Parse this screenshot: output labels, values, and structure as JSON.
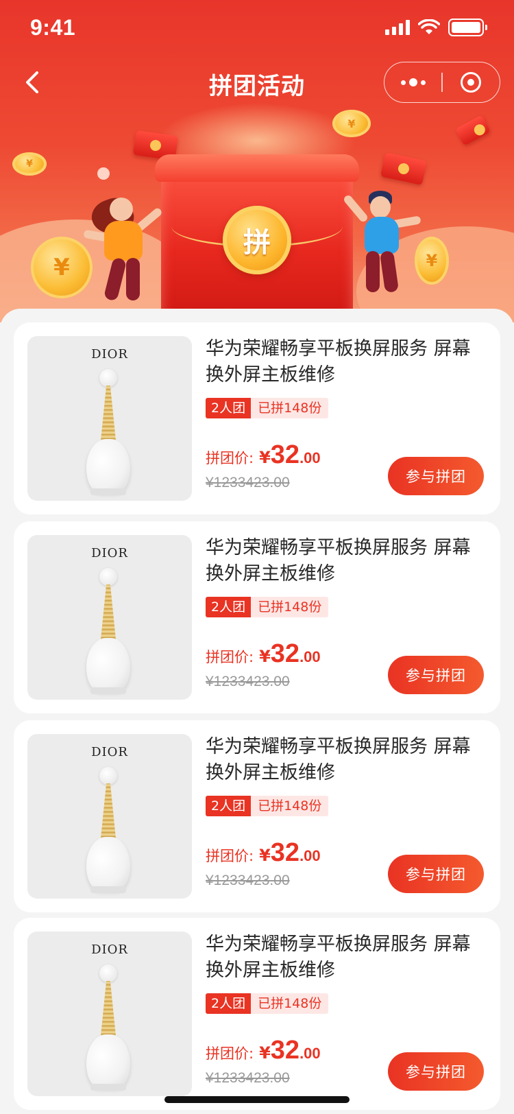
{
  "status_bar": {
    "time": "9:41"
  },
  "nav": {
    "title": "拼团活动"
  },
  "banner": {
    "coin_char": "拼",
    "coin_symbol": "¥"
  },
  "products": [
    {
      "title": "华为荣耀畅享平板换屏服务 屏幕换外屏主板维修",
      "brand": "DIOR",
      "group_tag": "2人团",
      "sold_tag": "已拼148份",
      "price_label": "拼团价:",
      "currency": "¥",
      "price_int": "32",
      "price_dec": ".00",
      "original_price": "¥1233423.00",
      "button": "参与拼团"
    },
    {
      "title": "华为荣耀畅享平板换屏服务 屏幕换外屏主板维修",
      "brand": "DIOR",
      "group_tag": "2人团",
      "sold_tag": "已拼148份",
      "price_label": "拼团价:",
      "currency": "¥",
      "price_int": "32",
      "price_dec": ".00",
      "original_price": "¥1233423.00",
      "button": "参与拼团"
    },
    {
      "title": "华为荣耀畅享平板换屏服务 屏幕换外屏主板维修",
      "brand": "DIOR",
      "group_tag": "2人团",
      "sold_tag": "已拼148份",
      "price_label": "拼团价:",
      "currency": "¥",
      "price_int": "32",
      "price_dec": ".00",
      "original_price": "¥1233423.00",
      "button": "参与拼团"
    },
    {
      "title": "华为荣耀畅享平板换屏服务 屏幕换外屏主板维修",
      "brand": "DIOR",
      "group_tag": "2人团",
      "sold_tag": "已拼148份",
      "price_label": "拼团价:",
      "currency": "¥",
      "price_int": "32",
      "price_dec": ".00",
      "original_price": "¥1233423.00",
      "button": "参与拼团"
    }
  ],
  "colors": {
    "brand_red": "#e93323",
    "hero_top": "#e8352b",
    "page_bg": "#f4f4f4"
  }
}
